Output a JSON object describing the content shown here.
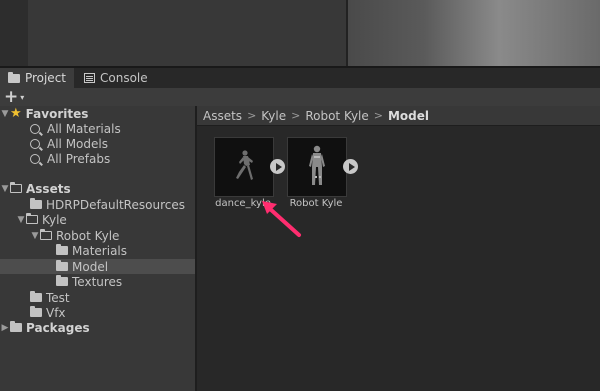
{
  "tabs": [
    {
      "label": "Project",
      "icon": "folder-icon",
      "active": true
    },
    {
      "label": "Console",
      "icon": "console-icon",
      "active": false
    }
  ],
  "toolbar": {
    "add_label": "+",
    "add_caret": "▾"
  },
  "tree": {
    "favorites": {
      "label": "Favorites",
      "items": [
        {
          "label": "All Materials"
        },
        {
          "label": "All Models"
        },
        {
          "label": "All Prefabs"
        }
      ]
    },
    "assets": {
      "label": "Assets",
      "children": [
        {
          "label": "HDRPDefaultResources"
        },
        {
          "label": "Kyle"
        },
        {
          "label": "Robot Kyle"
        },
        {
          "label": "Materials"
        },
        {
          "label": "Model",
          "selected": true
        },
        {
          "label": "Textures"
        },
        {
          "label": "Test"
        },
        {
          "label": "Vfx"
        }
      ]
    },
    "packages": {
      "label": "Packages"
    }
  },
  "breadcrumb": [
    "Assets",
    "Kyle",
    "Robot Kyle",
    "Model"
  ],
  "assets_grid": [
    {
      "label": "dance_kyle",
      "icon": "animation-clip-icon"
    },
    {
      "label": "Robot Kyle",
      "icon": "model-icon"
    }
  ],
  "colors": {
    "accent_pointer": "#ff2d6f",
    "star": "#f0c030",
    "selected_row": "#4d4d4d"
  }
}
